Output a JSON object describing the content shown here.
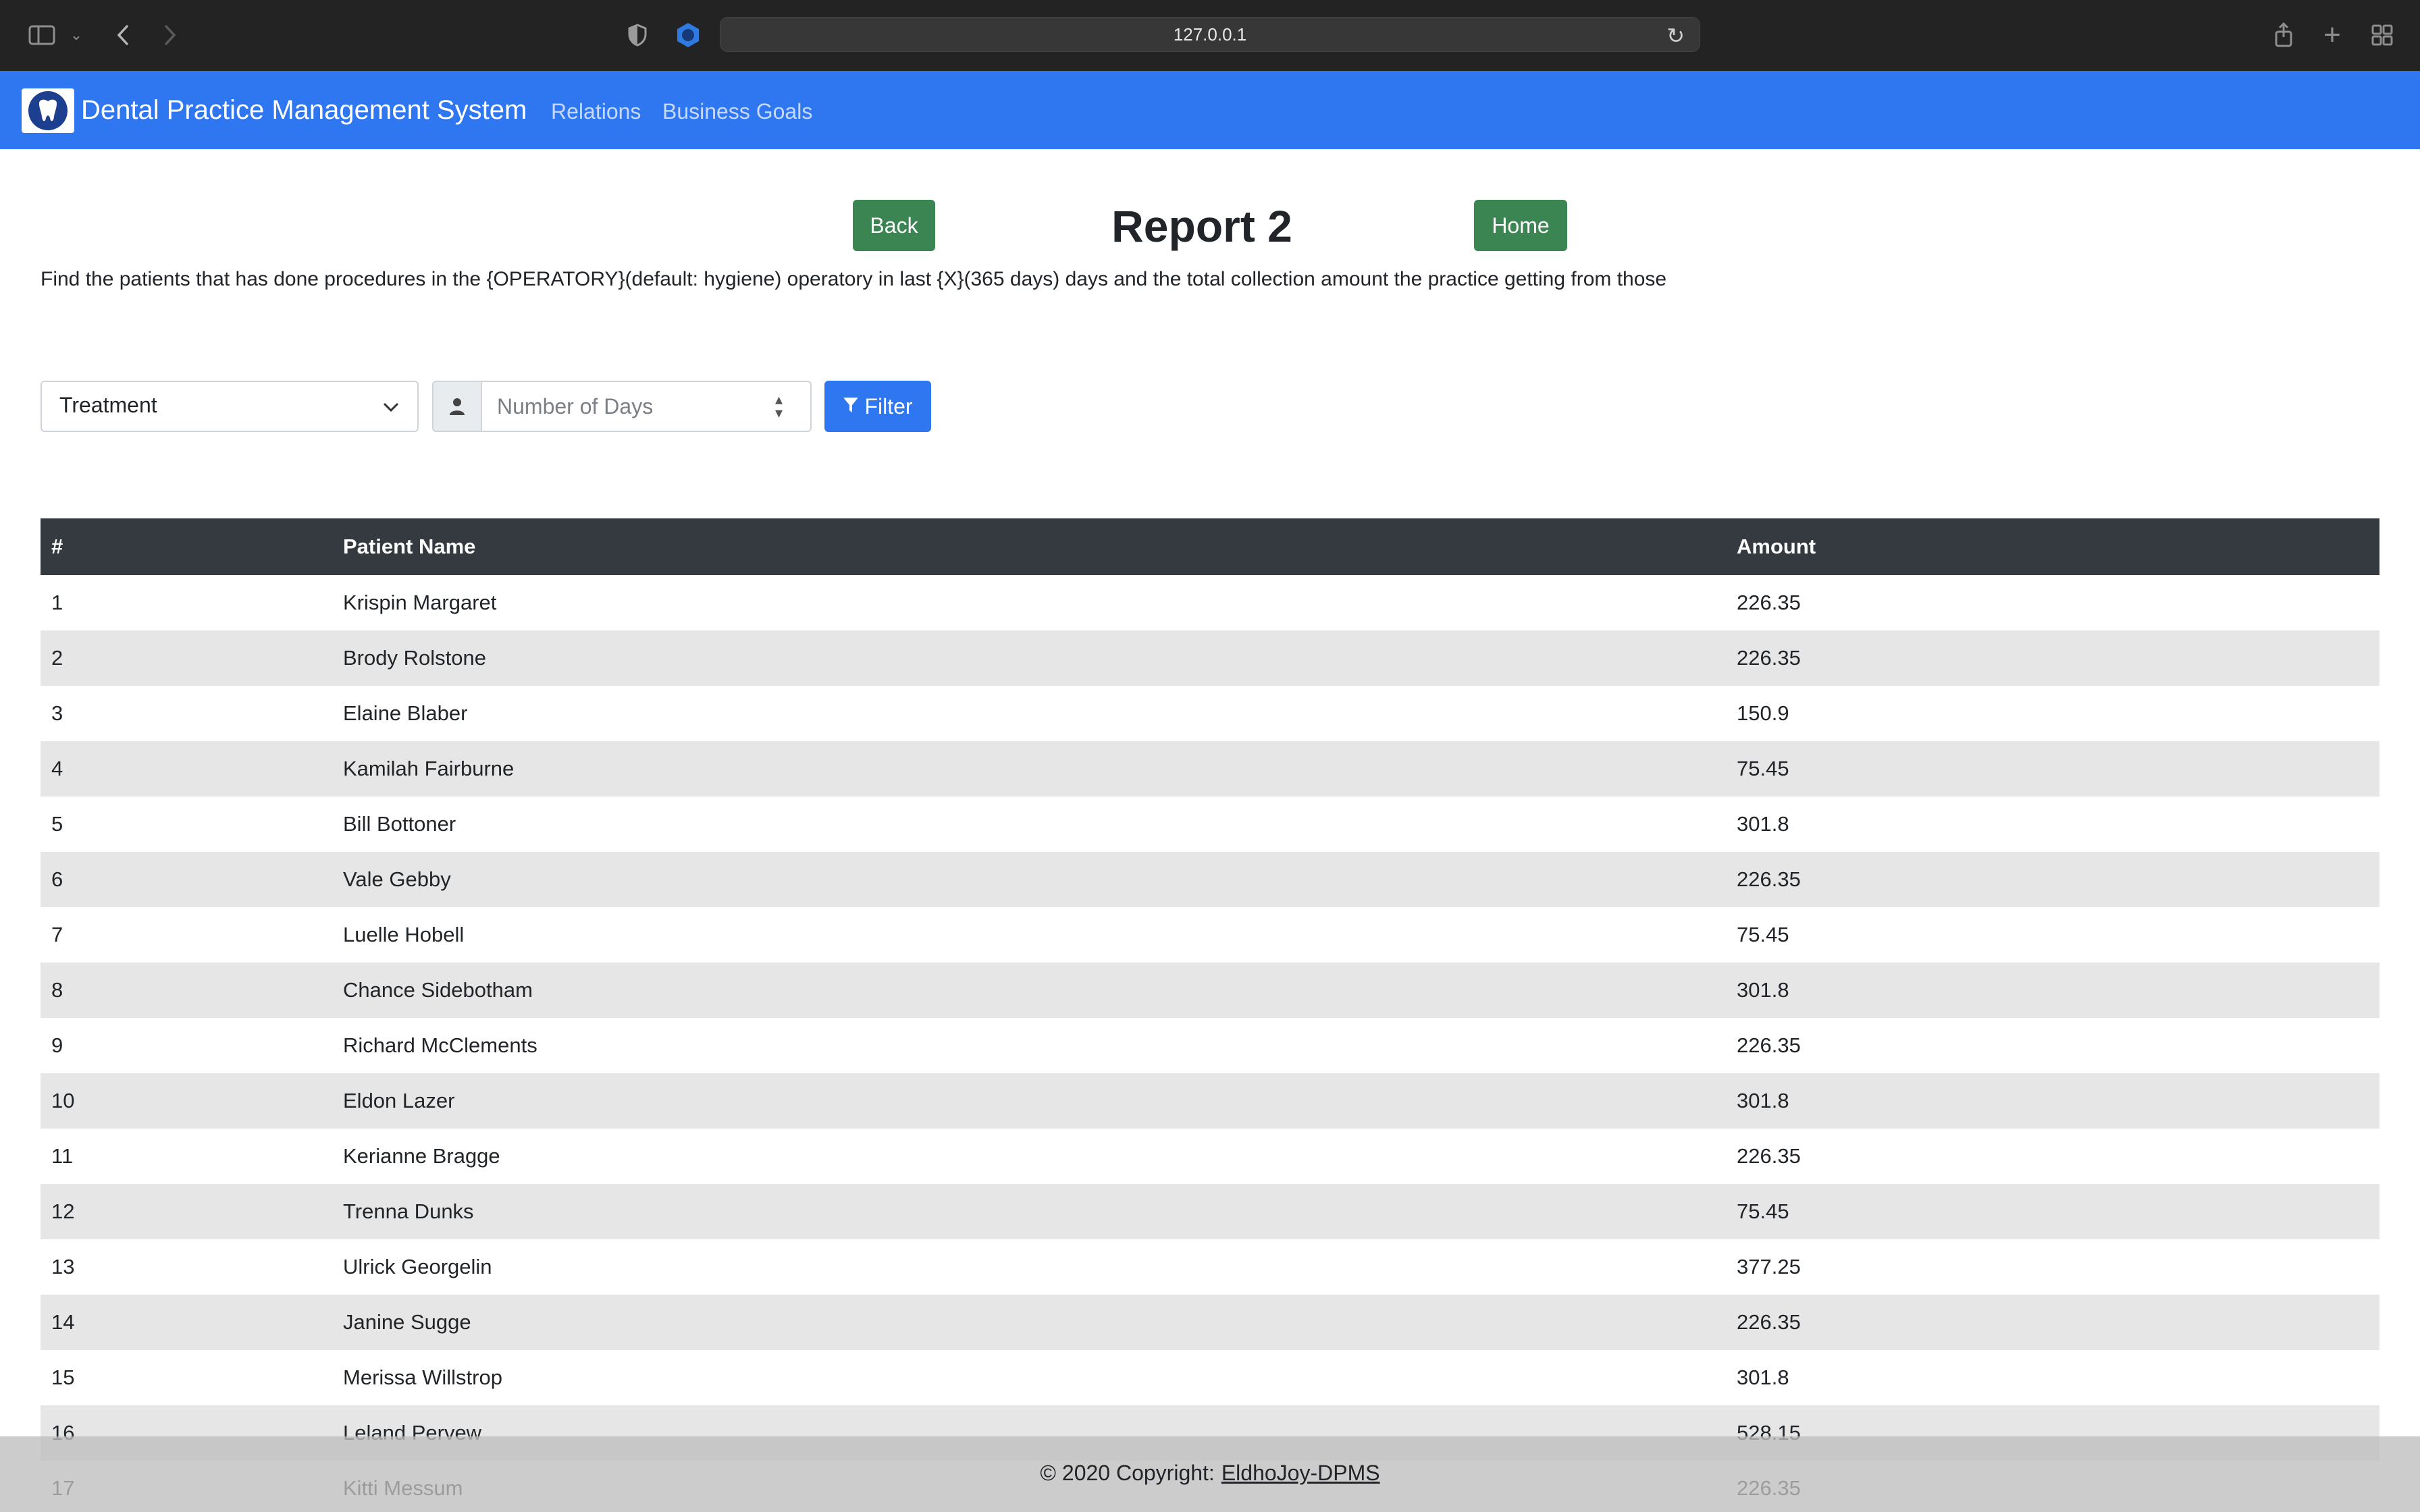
{
  "browser": {
    "url": "127.0.0.1"
  },
  "navbar": {
    "brand": "Dental Practice Management System",
    "links": [
      "Relations",
      "Business Goals"
    ]
  },
  "header": {
    "back_label": "Back",
    "title": "Report 2",
    "home_label": "Home",
    "description": "Find the patients that has done procedures in the {OPERATORY}(default: hygiene) operatory in last {X}(365 days) days and the total collection amount the practice getting from those"
  },
  "filter": {
    "operatory_selected": "Treatment",
    "days_placeholder": "Number of Days",
    "filter_label": "Filter"
  },
  "table": {
    "headers": [
      "#",
      "Patient Name",
      "Amount"
    ],
    "rows": [
      [
        "1",
        "Krispin Margaret",
        "226.35"
      ],
      [
        "2",
        "Brody Rolstone",
        "226.35"
      ],
      [
        "3",
        "Elaine Blaber",
        "150.9"
      ],
      [
        "4",
        "Kamilah Fairburne",
        "75.45"
      ],
      [
        "5",
        "Bill Bottoner",
        "301.8"
      ],
      [
        "6",
        "Vale Gebby",
        "226.35"
      ],
      [
        "7",
        "Luelle Hobell",
        "75.45"
      ],
      [
        "8",
        "Chance Sidebotham",
        "301.8"
      ],
      [
        "9",
        "Richard McClements",
        "226.35"
      ],
      [
        "10",
        "Eldon Lazer",
        "301.8"
      ],
      [
        "11",
        "Kerianne Bragge",
        "226.35"
      ],
      [
        "12",
        "Trenna Dunks",
        "75.45"
      ],
      [
        "13",
        "Ulrick Georgelin",
        "377.25"
      ],
      [
        "14",
        "Janine Sugge",
        "226.35"
      ],
      [
        "15",
        "Merissa Willstrop",
        "301.8"
      ],
      [
        "16",
        "Leland Pervew",
        "528.15"
      ],
      [
        "17",
        "Kitti Messum",
        "226.35"
      ]
    ]
  },
  "footer": {
    "text": "© 2020 Copyright:",
    "link": "EldhoJoy-DPMS"
  },
  "colors": {
    "navbar": "#2f77f0",
    "button_green": "#3b8552",
    "table_header": "#343a40"
  }
}
